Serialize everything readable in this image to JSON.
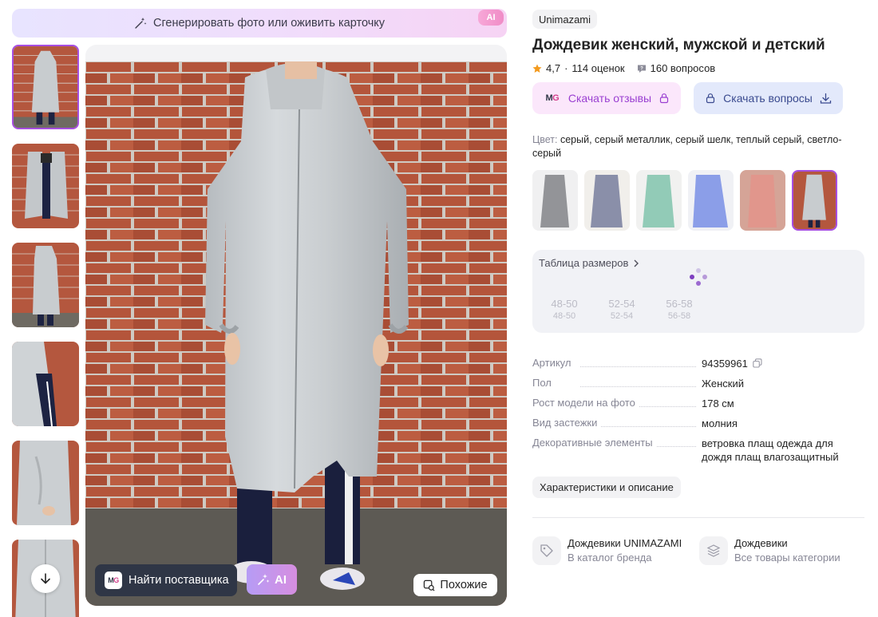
{
  "banner": {
    "text": "Сгенерировать фото или оживить карточку",
    "badge": "AI"
  },
  "photo_buttons": {
    "supplier": "Найти поставщика",
    "ai": "AI",
    "similar": "Похожие",
    "mg_logo": "MG"
  },
  "product": {
    "brand": "Unimazami",
    "title": "Дождевик женский, мужской и детский",
    "rating": "4,7",
    "reviews_count": "114 оценок",
    "questions_count": "160 вопросов"
  },
  "actions": {
    "reviews": "Скачать отзывы",
    "questions": "Скачать вопросы"
  },
  "color": {
    "label": "Цвет:",
    "value": "серый, серый металлик, серый шелк, теплый серый, светло-серый"
  },
  "sizes": {
    "title": "Таблица размеров",
    "items": [
      {
        "main": "48-50",
        "sub": "48-50"
      },
      {
        "main": "52-54",
        "sub": "52-54"
      },
      {
        "main": "56-58",
        "sub": "56-58"
      }
    ]
  },
  "specs": [
    {
      "key": "Артикул",
      "value": "94359961"
    },
    {
      "key": "Пол",
      "value": "Женский"
    },
    {
      "key": "Рост модели на фото",
      "value": "178 см"
    },
    {
      "key": "Вид застежки",
      "value": "молния"
    },
    {
      "key": "Декоративные элементы",
      "value": "ветровка плащ одежда для дождя плащ влагозащитный"
    }
  ],
  "characteristics_button": "Характеристики и описание",
  "links": [
    {
      "title": "Дождевики UNIMAZAMI",
      "subtitle": "В каталог бренда",
      "icon": "tag-icon"
    },
    {
      "title": "Дождевики",
      "subtitle": "Все товары категории",
      "icon": "layers-icon"
    }
  ],
  "colors": {
    "accent": "#a64ee0",
    "rating_star": "#f39a1e",
    "brick": "#b3553c"
  }
}
